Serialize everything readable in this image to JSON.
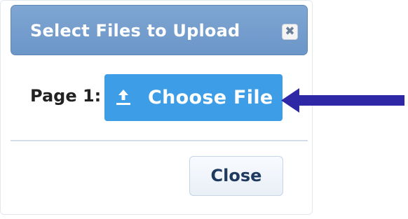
{
  "dialog": {
    "title": "Select Files to Upload",
    "close_icon_glyph": "✖",
    "page_label": "Page 1:",
    "choose_file_label": "Choose File",
    "close_button_label": "Close"
  },
  "icons": {
    "close": "close-icon",
    "upload": "upload-icon",
    "annotation_arrow": "left-arrow"
  },
  "colors": {
    "titlebar": "#6b96c8",
    "choose_button": "#3d9de7",
    "annotation_arrow": "#2e27a6"
  }
}
